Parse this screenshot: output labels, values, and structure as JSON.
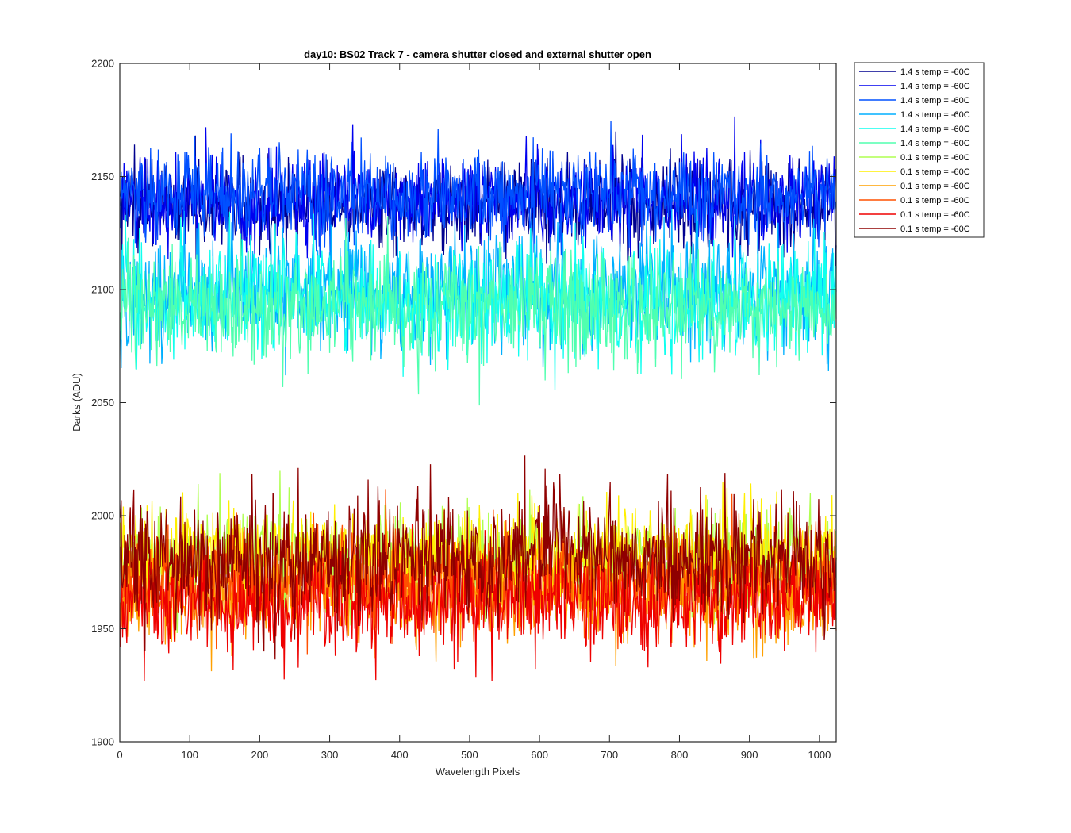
{
  "chart_data": {
    "type": "line",
    "title": "day10: BS02  Track 7 - camera shutter closed and external shutter open",
    "xlabel": "Wavelength Pixels",
    "ylabel": "Darks (ADU)",
    "xlim": [
      0,
      1024
    ],
    "ylim": [
      1900,
      2200
    ],
    "xticks": [
      0,
      100,
      200,
      300,
      400,
      500,
      600,
      700,
      800,
      900,
      1000
    ],
    "yticks": [
      1900,
      1950,
      2000,
      2050,
      2100,
      2150,
      2200
    ],
    "grid": false,
    "legend_position": "outside-top-right",
    "series": [
      {
        "name": "1.4 s temp = -60C",
        "color": "#00008F",
        "mean": 2138,
        "noise_sd": 10
      },
      {
        "name": "1.4 s temp = -60C",
        "color": "#0000EF",
        "mean": 2140,
        "noise_sd": 10
      },
      {
        "name": "1.4 s temp = -60C",
        "color": "#0050FF",
        "mean": 2142,
        "noise_sd": 10
      },
      {
        "name": "1.4 s temp = -60C",
        "color": "#00AFFF",
        "mean": 2100,
        "noise_sd": 13
      },
      {
        "name": "1.4 s temp = -60C",
        "color": "#10FFEF",
        "mean": 2096,
        "noise_sd": 13
      },
      {
        "name": "1.4 s temp = -60C",
        "color": "#50FFAF",
        "mean": 2092,
        "noise_sd": 12
      },
      {
        "name": "0.1 s temp = -60C",
        "color": "#AFFF50",
        "mean": 1980,
        "noise_sd": 11
      },
      {
        "name": "0.1 s temp = -60C",
        "color": "#FFEF00",
        "mean": 1982,
        "noise_sd": 11
      },
      {
        "name": "0.1 s temp = -60C",
        "color": "#FFA000",
        "mean": 1966,
        "noise_sd": 11
      },
      {
        "name": "0.1 s temp = -60C",
        "color": "#FF5000",
        "mean": 1972,
        "noise_sd": 11
      },
      {
        "name": "0.1 s temp = -60C",
        "color": "#EF0000",
        "mean": 1962,
        "noise_sd": 11
      },
      {
        "name": "0.1 s temp = -60C",
        "color": "#8F0000",
        "mean": 1980,
        "noise_sd": 13
      }
    ]
  }
}
